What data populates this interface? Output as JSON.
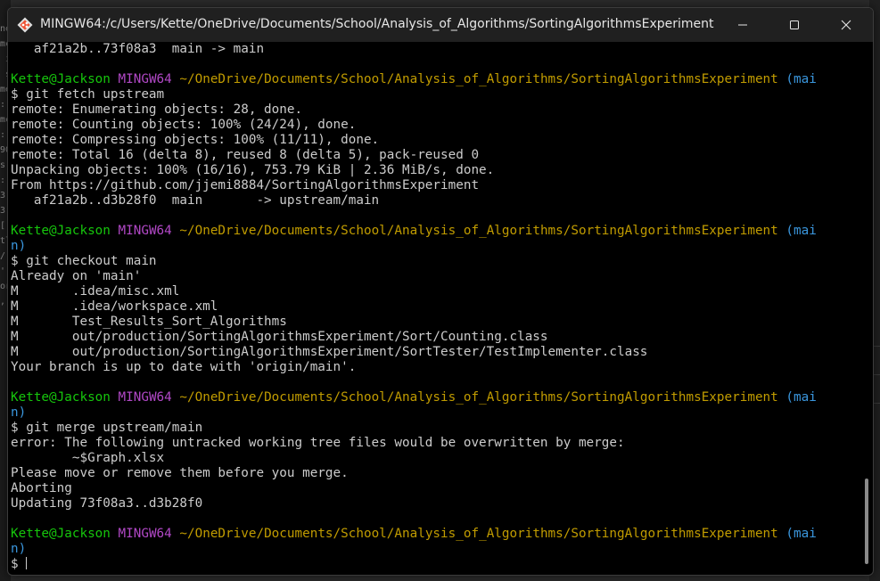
{
  "background": {
    "left_fragments": "ne\nmc\n i\n s\nme\n: \nmc\n: \n90\ns:\n:\n3[\n3\n[\ntl\n/\n'\nor\n, "
  },
  "window": {
    "title": "MINGW64:/c/Users/Kette/OneDrive/Documents/School/Analysis_of_Algorithms/SortingAlgorithmsExperiment"
  },
  "prompt": {
    "user_host": "Kette@Jackson",
    "system": "MINGW64",
    "path": "~/OneDrive/Documents/School/Analysis_of_Algorithms/SortingAlgorithmsExperiment",
    "branch_part1": "(mai",
    "branch_part2": "n)"
  },
  "terminal": {
    "line_top": "   af21a2b..73f08a3  main -> main",
    "cmd_fetch": "$ git fetch upstream",
    "fetch_output": [
      "remote: Enumerating objects: 28, done.",
      "remote: Counting objects: 100% (24/24), done.",
      "remote: Compressing objects: 100% (11/11), done.",
      "remote: Total 16 (delta 8), reused 8 (delta 5), pack-reused 0",
      "Unpacking objects: 100% (16/16), 753.79 KiB | 2.36 MiB/s, done.",
      "From https://github.com/jjemi8884/SortingAlgorithmsExperiment",
      "   af21a2b..d3b28f0  main       -> upstream/main"
    ],
    "cmd_checkout": "$ git checkout main",
    "checkout_output": [
      "Already on 'main'",
      "M       .idea/misc.xml",
      "M       .idea/workspace.xml",
      "M       Test_Results_Sort_Algorithms",
      "M       out/production/SortingAlgorithmsExperiment/Sort/Counting.class",
      "M       out/production/SortingAlgorithmsExperiment/SortTester/TestImplementer.class",
      "Your branch is up to date with 'origin/main'."
    ],
    "cmd_merge": "$ git merge upstream/main",
    "merge_output": [
      "error: The following untracked working tree files would be overwritten by merge:",
      "        ~$Graph.xlsx",
      "Please move or remove them before you merge.",
      "Aborting",
      "Updating 73f08a3..d3b28f0"
    ],
    "final_prompt_symbol": "$"
  },
  "icons": {
    "app": "git-bash-icon",
    "minimize": "minimize-icon",
    "maximize": "maximize-icon",
    "close": "close-icon"
  },
  "colors": {
    "terminal_bg": "#000000",
    "text": "#cccccc",
    "user_host": "#16c60c",
    "system": "#b148c6",
    "path": "#c19c00",
    "branch": "#3a96dd",
    "titlebar": "#202020"
  }
}
